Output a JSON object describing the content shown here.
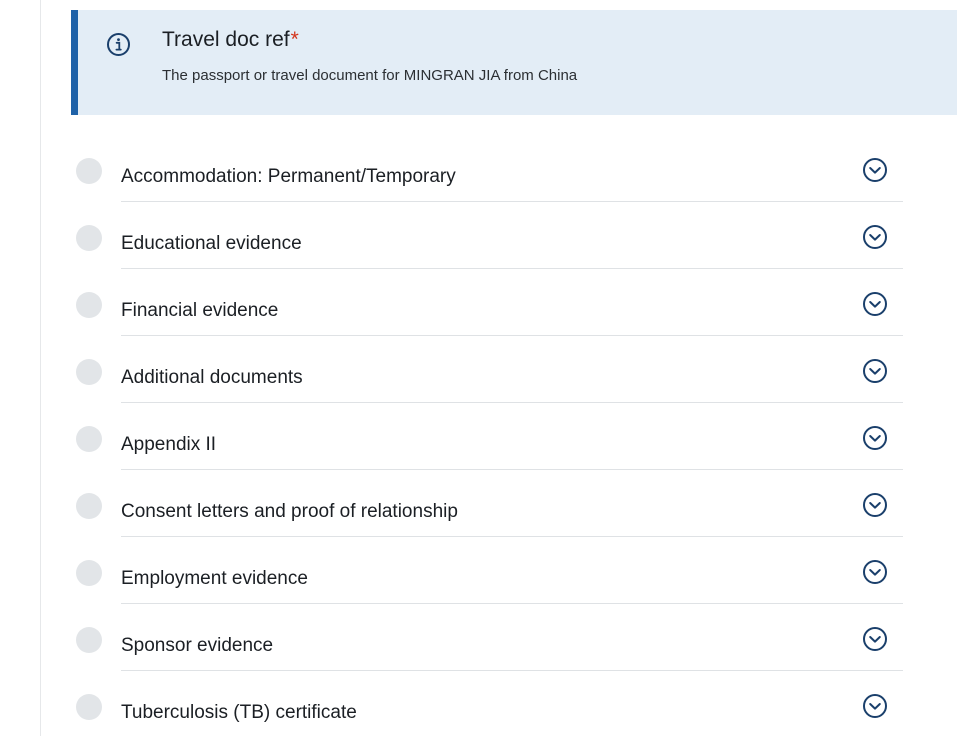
{
  "banner": {
    "title": "Travel doc ref",
    "required_marker": "*",
    "subtitle": "The passport or travel document for MINGRAN JIA from China",
    "icon": "info-icon",
    "accent_color": "#1f62a8",
    "background_color": "#e3edf6"
  },
  "documents": [
    {
      "label": "Accommodation: Permanent/Temporary",
      "icon": "chevron-down-circle-icon"
    },
    {
      "label": "Educational evidence",
      "icon": "chevron-down-circle-icon"
    },
    {
      "label": "Financial evidence",
      "icon": "chevron-down-circle-icon"
    },
    {
      "label": "Additional documents",
      "icon": "chevron-down-circle-icon"
    },
    {
      "label": "Appendix II",
      "icon": "chevron-down-circle-icon"
    },
    {
      "label": "Consent letters and proof of relationship",
      "icon": "chevron-down-circle-icon"
    },
    {
      "label": "Employment evidence",
      "icon": "chevron-down-circle-icon"
    },
    {
      "label": "Sponsor evidence",
      "icon": "chevron-down-circle-icon"
    },
    {
      "label": "Tuberculosis (TB) certificate",
      "icon": "chevron-down-circle-icon"
    }
  ],
  "colors": {
    "icon_color": "#1a3f6b",
    "status_dot": "#e2e5e8",
    "required": "#d4351c"
  }
}
